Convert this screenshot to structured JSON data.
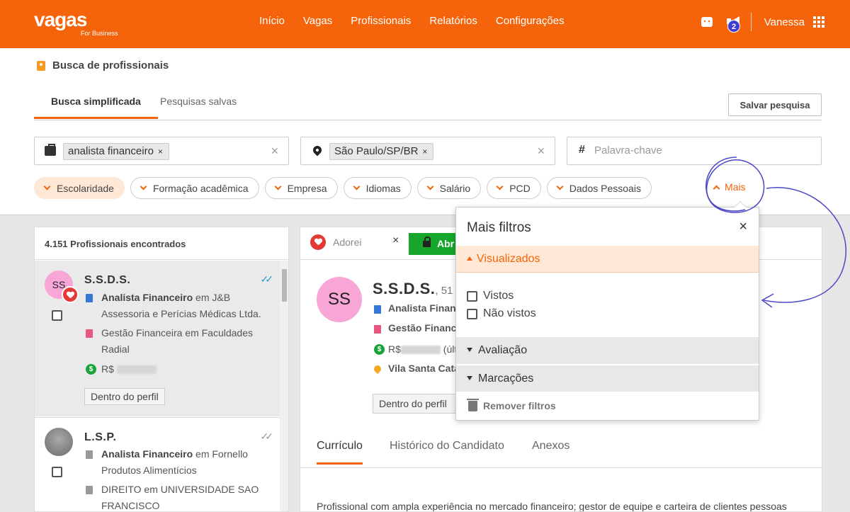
{
  "brand": {
    "logo": "vagas",
    "sub": "For Business",
    "color": "#f5640a"
  },
  "nav": [
    "Início",
    "Vagas",
    "Profissionais",
    "Relatórios",
    "Configurações"
  ],
  "notifications": {
    "count": "2"
  },
  "user": {
    "name": "Vanessa"
  },
  "page": {
    "title": "Busca de profissionais"
  },
  "tabs": {
    "simple": "Busca simplificada",
    "saved": "Pesquisas salvas",
    "save_button": "Salvar pesquisa"
  },
  "search": {
    "role_chip": "analista financeiro",
    "location_chip": "São Paulo/SP/BR",
    "keyword_placeholder": "Palavra-chave",
    "chip_remove": "×",
    "clear": "×"
  },
  "filters": [
    "Escolaridade",
    "Formação acadêmica",
    "Empresa",
    "Idiomas",
    "Salário",
    "PCD",
    "Dados Pessoais"
  ],
  "more_filter": "Mais",
  "results": {
    "count_label": "4.151 Profissionais encontrados",
    "items": [
      {
        "initials": "SS",
        "name": "S.S.D.S.",
        "role": "Analista Financeiro",
        "company": " em J&B Assessoria e Perícias Médicas Ltda.",
        "education": "Gestão Financeira em Faculdades Radial",
        "salary_prefix": "R$",
        "tag": "Dentro do perfil",
        "check": "✓✓"
      },
      {
        "name": "L.S.P.",
        "role": "Analista Financeiro",
        "company": " em Fornello Produtos Alimentícios",
        "education": "DIREITO em UNIVERSIDADE SAO FRANCISCO",
        "check": "✓✓"
      }
    ]
  },
  "detail": {
    "adorei": "Adorei",
    "close": "×",
    "open_button": "Abr",
    "initials": "SS",
    "name": "S.S.D.S.",
    "age": ", 51 a",
    "role": "Analista Financ",
    "education": "Gestão Financ",
    "salary": "R$",
    "salary_suffix": "(últ",
    "location": "Vila Santa Cata",
    "tag": "Dentro do perfil",
    "tabs": [
      "Currículo",
      "Histórico do Candidato",
      "Anexos"
    ],
    "summary": "Profissional com ampla experiência no mercado financeiro; gestor de equipe e carteira de clientes pessoas"
  },
  "popup": {
    "title": "Mais filtros",
    "close": "×",
    "section_open": "Visualizados",
    "options": [
      "Vistos",
      "Não vistos"
    ],
    "sections": [
      "Avaliação",
      "Marcações"
    ],
    "remove": "Remover filtros"
  }
}
